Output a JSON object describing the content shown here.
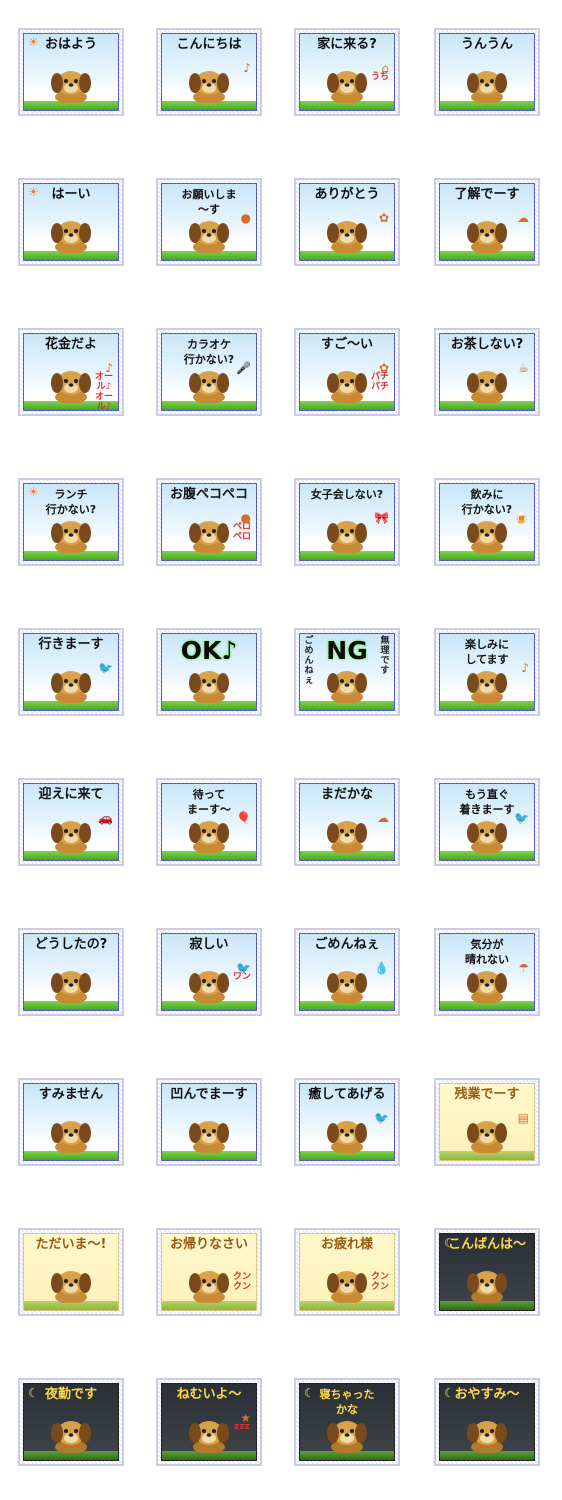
{
  "stickers": [
    {
      "caption": "おはよう",
      "theme": "sky",
      "icon": "sun-icon"
    },
    {
      "caption": "こんにちは",
      "theme": "sky",
      "icon": "music-note-icon"
    },
    {
      "caption": "家に来る?",
      "theme": "sky",
      "side": "うち",
      "icon": "doghouse-icon"
    },
    {
      "caption": "うんうん",
      "theme": "sky",
      "icon": ""
    },
    {
      "caption": "はーい",
      "theme": "sky",
      "icon": "sun-icon"
    },
    {
      "caption": "お願いしま\n〜す",
      "theme": "sky",
      "icon": "bowl-icon"
    },
    {
      "caption": "ありがとう",
      "theme": "sky",
      "icon": "flower-icon"
    },
    {
      "caption": "了解でーす",
      "theme": "sky",
      "icon": "cloud-icon"
    },
    {
      "caption": "花金だよ",
      "theme": "sky",
      "side": "オール♪\nオール♪",
      "icon": "music-note-icon"
    },
    {
      "caption": "カラオケ\n行かない?",
      "theme": "sky",
      "icon": "microphone-icon"
    },
    {
      "caption": "すご〜い",
      "theme": "sky",
      "side": "パチ\nパチ",
      "icon": "flower-icon"
    },
    {
      "caption": "お茶しない?",
      "theme": "sky",
      "icon": "teacup-icon"
    },
    {
      "caption": "ランチ\n行かない?",
      "theme": "sky",
      "icon": "sun-icon"
    },
    {
      "caption": "お腹ペコペコ",
      "theme": "sky",
      "side": "ペロ\nペロ",
      "icon": "bowl-icon"
    },
    {
      "caption": "女子会しない?",
      "theme": "sky",
      "icon": "ribbon-icon"
    },
    {
      "caption": "飲みに\n行かない?",
      "theme": "sky",
      "icon": "beer-icon"
    },
    {
      "caption": "行きまーす",
      "theme": "sky",
      "icon": "bird-icon"
    },
    {
      "caption": "OK♪",
      "theme": "sky",
      "big": true,
      "icon": ""
    },
    {
      "caption": "NG",
      "theme": "sky",
      "big": true,
      "side": "無理です",
      "sideLeft": "ごめんねぇ",
      "icon": ""
    },
    {
      "caption": "楽しみに\nしてます",
      "theme": "sky",
      "icon": "music-note-icon"
    },
    {
      "caption": "迎えに来て",
      "theme": "sky",
      "icon": "car-icon"
    },
    {
      "caption": "待って\nまーす〜",
      "theme": "sky",
      "icon": "balloon-icon"
    },
    {
      "caption": "まだかな",
      "theme": "sky",
      "icon": "cloud-icon"
    },
    {
      "caption": "もう直ぐ\n着きまーす",
      "theme": "sky",
      "icon": "bird-icon"
    },
    {
      "caption": "どうしたの?",
      "theme": "sky",
      "icon": ""
    },
    {
      "caption": "寂しい",
      "theme": "sky",
      "side": "ワン",
      "icon": "bird-icon"
    },
    {
      "caption": "ごめんねぇ",
      "theme": "sky",
      "icon": "tear-icon"
    },
    {
      "caption": "気分が\n晴れない",
      "theme": "sky",
      "icon": "raincloud-icon"
    },
    {
      "caption": "すみません",
      "theme": "sky",
      "icon": ""
    },
    {
      "caption": "凹んでまーす",
      "theme": "sky",
      "icon": ""
    },
    {
      "caption": "癒してあげる",
      "theme": "sky",
      "icon": "bird-icon"
    },
    {
      "caption": "残業でーす",
      "theme": "cream",
      "icon": "documents-icon"
    },
    {
      "caption": "ただいま〜!",
      "theme": "cream",
      "icon": ""
    },
    {
      "caption": "お帰りなさい",
      "theme": "cream",
      "side": "クン\nクン",
      "icon": ""
    },
    {
      "caption": "お疲れ様",
      "theme": "cream",
      "side": "クン\nクン",
      "icon": ""
    },
    {
      "caption": "こんばんは〜",
      "theme": "night",
      "icon": "moon-icon"
    },
    {
      "caption": "夜勤です",
      "theme": "night",
      "icon": "moon-icon"
    },
    {
      "caption": "ねむいよ〜",
      "theme": "night",
      "side": "zzz",
      "icon": "star-icon"
    },
    {
      "caption": "寝ちゃった\nかな",
      "theme": "night",
      "icon": "moon-icon"
    },
    {
      "caption": "おやすみ〜",
      "theme": "night",
      "icon": "moon-icon"
    }
  ]
}
